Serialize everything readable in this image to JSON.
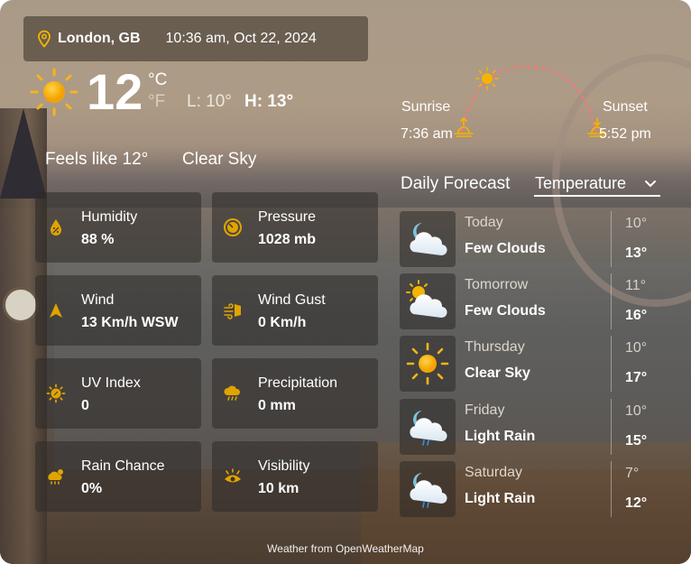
{
  "header": {
    "location": "London, GB",
    "datetime": "10:36 am, Oct 22, 2024",
    "location_icon": "map-pin-icon"
  },
  "current": {
    "icon": "sun-icon",
    "temperature": "12",
    "unit_celsius": "°C",
    "unit_fahrenheit": "°F",
    "low": "L: 10°",
    "high": "H: 13°",
    "feels_like": "Feels like 12°",
    "description": "Clear Sky"
  },
  "sun": {
    "sunrise_label": "Sunrise",
    "sunrise_time": "7:36 am",
    "sunset_label": "Sunset",
    "sunset_time": "5:52 pm"
  },
  "details": [
    {
      "label": "Humidity",
      "value": "88 %",
      "icon": "humidity-drop-icon"
    },
    {
      "label": "Pressure",
      "value": "1028 mb",
      "icon": "pressure-gauge-icon"
    },
    {
      "label": "Wind",
      "value": "13 Km/h WSW",
      "icon": "wind-direction-arrow-icon"
    },
    {
      "label": "Wind Gust",
      "value": "0 Km/h",
      "icon": "wind-gust-icon"
    },
    {
      "label": "UV Index",
      "value": "0",
      "icon": "uv-sun-icon"
    },
    {
      "label": "Precipitation",
      "value": "0 mm",
      "icon": "precipitation-cloud-icon"
    },
    {
      "label": "Rain Chance",
      "value": "0%",
      "icon": "rain-chance-cloud-icon"
    },
    {
      "label": "Visibility",
      "value": "10 km",
      "icon": "visibility-eye-icon"
    }
  ],
  "forecast": {
    "title": "Daily Forecast",
    "selector_value": "Temperature",
    "days": [
      {
        "day": "Today",
        "condition": "Few Clouds",
        "low": "10°",
        "high": "13°",
        "icon": "night-cloud-icon"
      },
      {
        "day": "Tomorrow",
        "condition": "Few Clouds",
        "low": "11°",
        "high": "16°",
        "icon": "sun-cloud-icon"
      },
      {
        "day": "Thursday",
        "condition": "Clear Sky",
        "low": "10°",
        "high": "17°",
        "icon": "sun-icon"
      },
      {
        "day": "Friday",
        "condition": "Light Rain",
        "low": "10°",
        "high": "15°",
        "icon": "night-rain-cloud-icon"
      },
      {
        "day": "Saturday",
        "condition": "Light Rain",
        "low": "7°",
        "high": "12°",
        "icon": "night-rain-cloud-icon"
      }
    ]
  },
  "footer": {
    "attribution": "Weather from OpenWeatherMap"
  },
  "colors": {
    "accent": "#f5b400",
    "arc": "#f07a7a"
  }
}
